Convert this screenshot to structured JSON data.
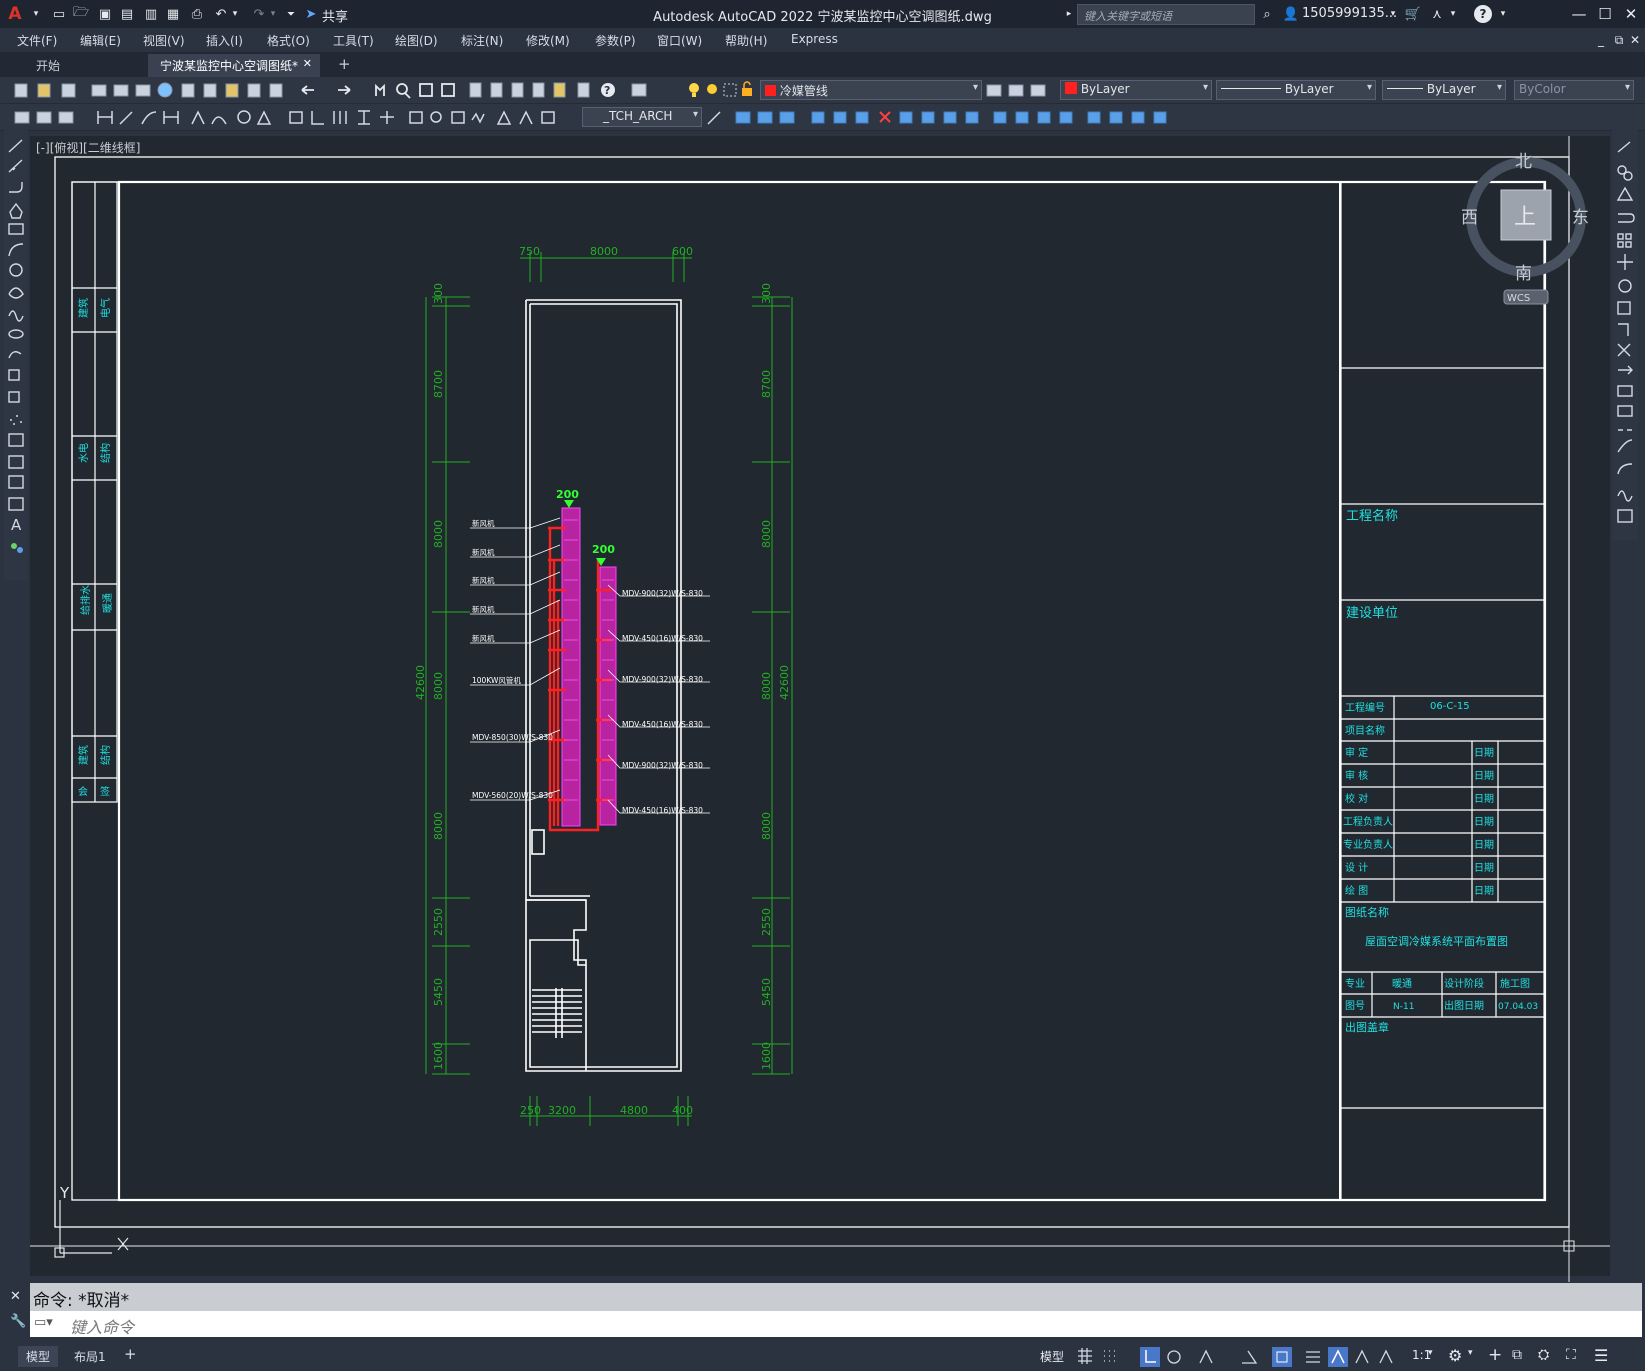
{
  "titlebar": {
    "app_logo": "A",
    "share_label": "共享",
    "title": "Autodesk AutoCAD 2022    宁波某监控中心空调图纸.dwg",
    "search_placeholder": "键入关键字或短语",
    "user": "1505999135...",
    "help_icon": "?"
  },
  "menu": [
    "文件(F)",
    "编辑(E)",
    "视图(V)",
    "插入(I)",
    "格式(O)",
    "工具(T)",
    "绘图(D)",
    "标注(N)",
    "修改(M)",
    "参数(P)",
    "窗口(W)",
    "帮助(H)",
    "Express"
  ],
  "tabs": [
    {
      "label": "开始"
    },
    {
      "label": "宁波某监控中心空调图纸*"
    }
  ],
  "toolbar": {
    "layer": "冷媒管线",
    "color": "ByLayer",
    "linetype": "ByLayer",
    "lineweight": "ByLayer",
    "plotstyle": "ByColor",
    "textstyle": "_TCH_ARCH"
  },
  "viewport_label": "[-][俯视][二维线框]",
  "viewcube": {
    "north": "北",
    "south": "南",
    "east": "东",
    "west": "西",
    "top": "上",
    "wcs": "WCS"
  },
  "ucs": {
    "x": "X",
    "y": "Y"
  },
  "plan": {
    "top_dims": [
      "750",
      "8000",
      "600"
    ],
    "bottom_dims": [
      "250",
      "3200",
      "4800",
      "400"
    ],
    "left_dims": [
      "300",
      "8700",
      "8000",
      "42600",
      "8000",
      "8000",
      "2550",
      "5450",
      "1600"
    ],
    "right_dims": [
      "300",
      "8700",
      "8000",
      "8000",
      "42600",
      "8000",
      "2550",
      "5450",
      "1600"
    ],
    "pipe_size_1": "200",
    "pipe_size_2": "200",
    "left_labels": [
      "新风机",
      "新风机",
      "新风机",
      "新风机",
      "新风机",
      "100KW风管机",
      "MDV-850(30)W/S-830",
      "MDV-560(20)W/S-830"
    ],
    "right_labels": [
      "MDV-900(32)W/S-830",
      "MDV-450(16)W/S-830",
      "MDV-900(32)W/S-830",
      "MDV-450(16)W/S-830",
      "MDV-900(32)W/S-830",
      "MDV-450(16)W/S-830"
    ]
  },
  "sign_column": {
    "rows": [
      [
        "建筑",
        "电气"
      ],
      [
        "水电",
        "结构"
      ],
      [
        "给排水",
        "暖通"
      ],
      [
        "建筑",
        "结构"
      ],
      [
        "会",
        "签"
      ]
    ]
  },
  "title_block": {
    "project_name_label": "工程名称",
    "client_label": "建设单位",
    "project_no_label": "工程编号",
    "project_no": "06-C-15",
    "item_name_label": "项目名称",
    "roles": [
      "审 定",
      "审 核",
      "校 对",
      "工程负责人",
      "专业负责人",
      "设 计",
      "绘 图"
    ],
    "date_label": "日期",
    "drawing_name_label": "图纸名称",
    "drawing_name": "屋面空调冷媒系统平面布置图",
    "discipline_label": "专业",
    "discipline": "暖通",
    "stage_label": "设计阶段",
    "stage": "施工图",
    "drawing_no_label": "图号",
    "drawing_no": "N-11",
    "issue_date_label": "出图日期",
    "issue_date": "07.04.03",
    "seal_label": "出图盖章"
  },
  "command": {
    "history": "命令:  *取消*",
    "placeholder": "键入命令"
  },
  "status": {
    "layouts": [
      "模型",
      "布局1"
    ],
    "model_label": "模型",
    "scale": "1:1"
  },
  "colors": {
    "accent_red": "#ff2020",
    "pipe_magenta": "#d040e0",
    "dim_green": "#22b022",
    "label_cyan": "#20e0e0",
    "frame_white": "#ffffff"
  }
}
